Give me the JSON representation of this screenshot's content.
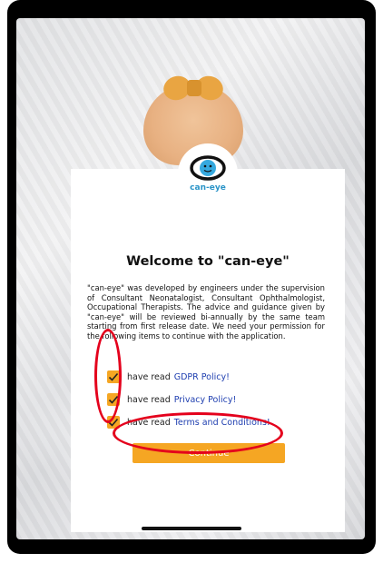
{
  "app": {
    "logo_text": "can-eye"
  },
  "welcome": {
    "title": "Welcome to \"can-eye\"",
    "description": "\"can-eye\" was developed by engineers under the supervision of Consultant Neonatalogist, Consultant Ophthalmologist, Occupational Therapists. The advice and guidance given by \"can-eye\" will be reviewed bi-annually by the same team starting from first release date. We need your permission for the following items to continue with the application."
  },
  "consents": [
    {
      "prefix": "have read",
      "link": "GDPR Policy!",
      "checked": true
    },
    {
      "prefix": "have read",
      "link": "Privacy Policy!",
      "checked": true
    },
    {
      "prefix": "have read",
      "link": "Terms and Conditions!",
      "checked": true
    }
  ],
  "actions": {
    "continue_label": "Continue"
  },
  "colors": {
    "accent": "#f5a623",
    "link": "#1f3fb0",
    "logo": "#2b94c8",
    "annotation": "#e4001c"
  }
}
